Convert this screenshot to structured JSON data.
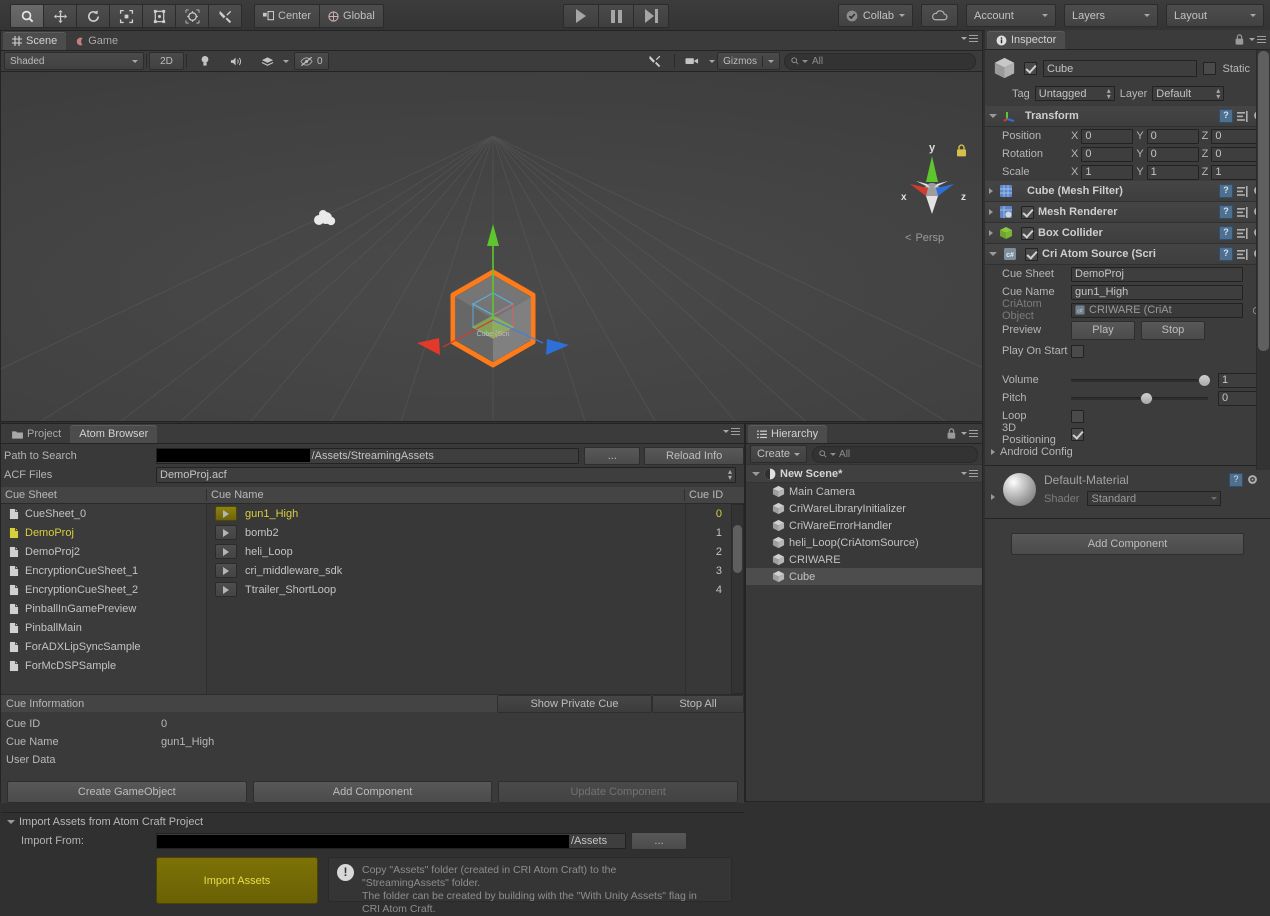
{
  "toolbar": {
    "tools": [
      {
        "name": "hand-tool",
        "icon": "hand-icon"
      },
      {
        "name": "move-tool",
        "icon": "move-icon"
      },
      {
        "name": "rotate-tool",
        "icon": "rotate-icon"
      },
      {
        "name": "scale-tool",
        "icon": "scale-icon"
      },
      {
        "name": "rect-tool",
        "icon": "rect-icon"
      },
      {
        "name": "transform-tool",
        "icon": "transform-icon"
      },
      {
        "name": "custom-tool",
        "icon": "wrench-icon"
      }
    ],
    "pivot_mode": "Center",
    "pivot_rotation": "Global",
    "play": "play-icon",
    "pause": "pause-icon",
    "step": "step-icon",
    "collab": "Collab",
    "cloud": "cloud-icon",
    "account": "Account",
    "layers": "Layers",
    "layout": "Layout"
  },
  "scene": {
    "tabs": [
      {
        "label": "Scene",
        "icon": "grid-icon",
        "active": true
      },
      {
        "label": "Game",
        "icon": "gamepad-icon",
        "active": false
      }
    ],
    "draw_mode": "Shaded",
    "mode_2d": "2D",
    "lighting_icon": "light-icon",
    "audio_icon": "audio-icon",
    "fx_icon": "effects-icon",
    "hidden_count": "0",
    "gizmos": "Gizmos",
    "search_placeholder": "All",
    "search_value": "All",
    "axis_x": "x",
    "axis_y": "y",
    "axis_z": "z",
    "projection": "Persp"
  },
  "inspector": {
    "tab": "Inspector",
    "object_name": "Cube",
    "object_enabled": true,
    "static_label": "Static",
    "static_checked": false,
    "tag_label": "Tag",
    "tag_value": "Untagged",
    "layer_label": "Layer",
    "layer_value": "Default",
    "transform": {
      "title": "Transform",
      "rows": [
        {
          "label": "Position",
          "x": "0",
          "y": "0",
          "z": "0"
        },
        {
          "label": "Rotation",
          "x": "0",
          "y": "0",
          "z": "0"
        },
        {
          "label": "Scale",
          "x": "1",
          "y": "1",
          "z": "1"
        }
      ]
    },
    "components": [
      {
        "title": "Cube (Mesh Filter)",
        "has_checkbox": false,
        "checked": false,
        "icon": "mesh-filter-icon",
        "expanded": false
      },
      {
        "title": "Mesh Renderer",
        "has_checkbox": true,
        "checked": true,
        "icon": "mesh-renderer-icon",
        "expanded": false
      },
      {
        "title": "Box Collider",
        "has_checkbox": true,
        "checked": true,
        "icon": "box-collider-icon",
        "expanded": false
      }
    ],
    "cri_atom_source": {
      "title": "Cri Atom Source (Scri",
      "checked": true,
      "cue_sheet_label": "Cue Sheet",
      "cue_sheet_value": "DemoProj",
      "cue_name_label": "Cue Name",
      "cue_name_value": "gun1_High",
      "criatom_object_label": "CriAtom Object",
      "criatom_object_value": "CRIWARE (CriAt",
      "preview_label": "Preview",
      "play_label": "Play",
      "stop_label": "Stop",
      "play_on_start_label": "Play On Start",
      "play_on_start_checked": false,
      "volume_label": "Volume",
      "volume_value": "1",
      "volume_pct": 93,
      "pitch_label": "Pitch",
      "pitch_value": "0",
      "pitch_pct": 50,
      "loop_label": "Loop",
      "loop_checked": false,
      "positioning_label": "3D Positioning",
      "positioning_checked": true,
      "android_config_label": "Android Config"
    },
    "material": {
      "name": "Default-Material",
      "shader_label": "Shader",
      "shader_value": "Standard"
    },
    "add_component": "Add Component"
  },
  "hierarchy": {
    "tab": "Hierarchy",
    "create_label": "Create",
    "search_placeholder": "All",
    "search_value": "All",
    "scene_name": "New Scene*",
    "items": [
      {
        "label": "Main Camera",
        "selected": false
      },
      {
        "label": "CriWareLibraryInitializer",
        "selected": false
      },
      {
        "label": "CriWareErrorHandler",
        "selected": false
      },
      {
        "label": "heli_Loop(CriAtomSource)",
        "selected": false
      },
      {
        "label": "CRIWARE",
        "selected": false
      },
      {
        "label": "Cube",
        "selected": true
      }
    ]
  },
  "atom_browser": {
    "tabs": [
      {
        "label": "Project",
        "icon": "folder-icon",
        "active": false
      },
      {
        "label": "Atom Browser",
        "icon": "",
        "active": true
      }
    ],
    "path_label": "Path to Search",
    "path_redacted": true,
    "path_value": "/Assets/StreamingAssets",
    "browse_label": "...",
    "reload_label": "Reload Info",
    "acf_label": "ACF Files",
    "acf_value": "DemoProj.acf",
    "col_cue_sheet": "Cue Sheet",
    "col_cue_name": "Cue Name",
    "col_cue_id": "Cue ID",
    "cue_sheets": [
      {
        "label": "CueSheet_0",
        "selected": false
      },
      {
        "label": "DemoProj",
        "selected": true
      },
      {
        "label": "DemoProj2",
        "selected": false
      },
      {
        "label": "EncryptionCueSheet_1",
        "selected": false
      },
      {
        "label": "EncryptionCueSheet_2",
        "selected": false
      },
      {
        "label": "PinballInGamePreview",
        "selected": false
      },
      {
        "label": "PinballMain",
        "selected": false
      },
      {
        "label": "ForADXLipSyncSample",
        "selected": false
      },
      {
        "label": "ForMcDSPSample",
        "selected": false
      }
    ],
    "cues": [
      {
        "name": "gun1_High",
        "id": "0",
        "selected": true
      },
      {
        "name": "bomb2",
        "id": "1",
        "selected": false
      },
      {
        "name": "heli_Loop",
        "id": "2",
        "selected": false
      },
      {
        "name": "cri_middleware_sdk",
        "id": "3",
        "selected": false
      },
      {
        "name": "Ttrailer_ShortLoop",
        "id": "4",
        "selected": false
      }
    ],
    "cue_information_title": "Cue Information",
    "show_private_cue": "Show Private Cue",
    "stop_all": "Stop All",
    "info_rows": [
      {
        "label": "Cue ID",
        "value": "0"
      },
      {
        "label": "Cue Name",
        "value": "gun1_High"
      },
      {
        "label": "User Data",
        "value": ""
      }
    ],
    "create_gameobject": "Create GameObject",
    "add_component": "Add Component",
    "update_component": "Update Component",
    "import_section_title": "Import Assets from Atom Craft Project",
    "import_from_label": "Import From:",
    "import_from_redacted": true,
    "import_from_value": "/Assets",
    "import_browse": "...",
    "import_button": "Import Assets",
    "import_note_line1": "Copy \"Assets\" folder (created in CRI Atom Craft) to the",
    "import_note_line2": "\"StreamingAssets\" folder.",
    "import_note_line3": "The folder can be created by building with the \"With Unity Assets\" flag in",
    "import_note_line4": "CRI Atom Craft."
  },
  "colors": {
    "accent_yellow": "#d8cf3c",
    "selection": "#4d4d4d",
    "panel_bg": "#393939",
    "gizmo_x": "#d33b2e",
    "gizmo_y": "#5fc52e",
    "gizmo_z": "#2f6fd8",
    "outline": "#ff7b1a"
  }
}
